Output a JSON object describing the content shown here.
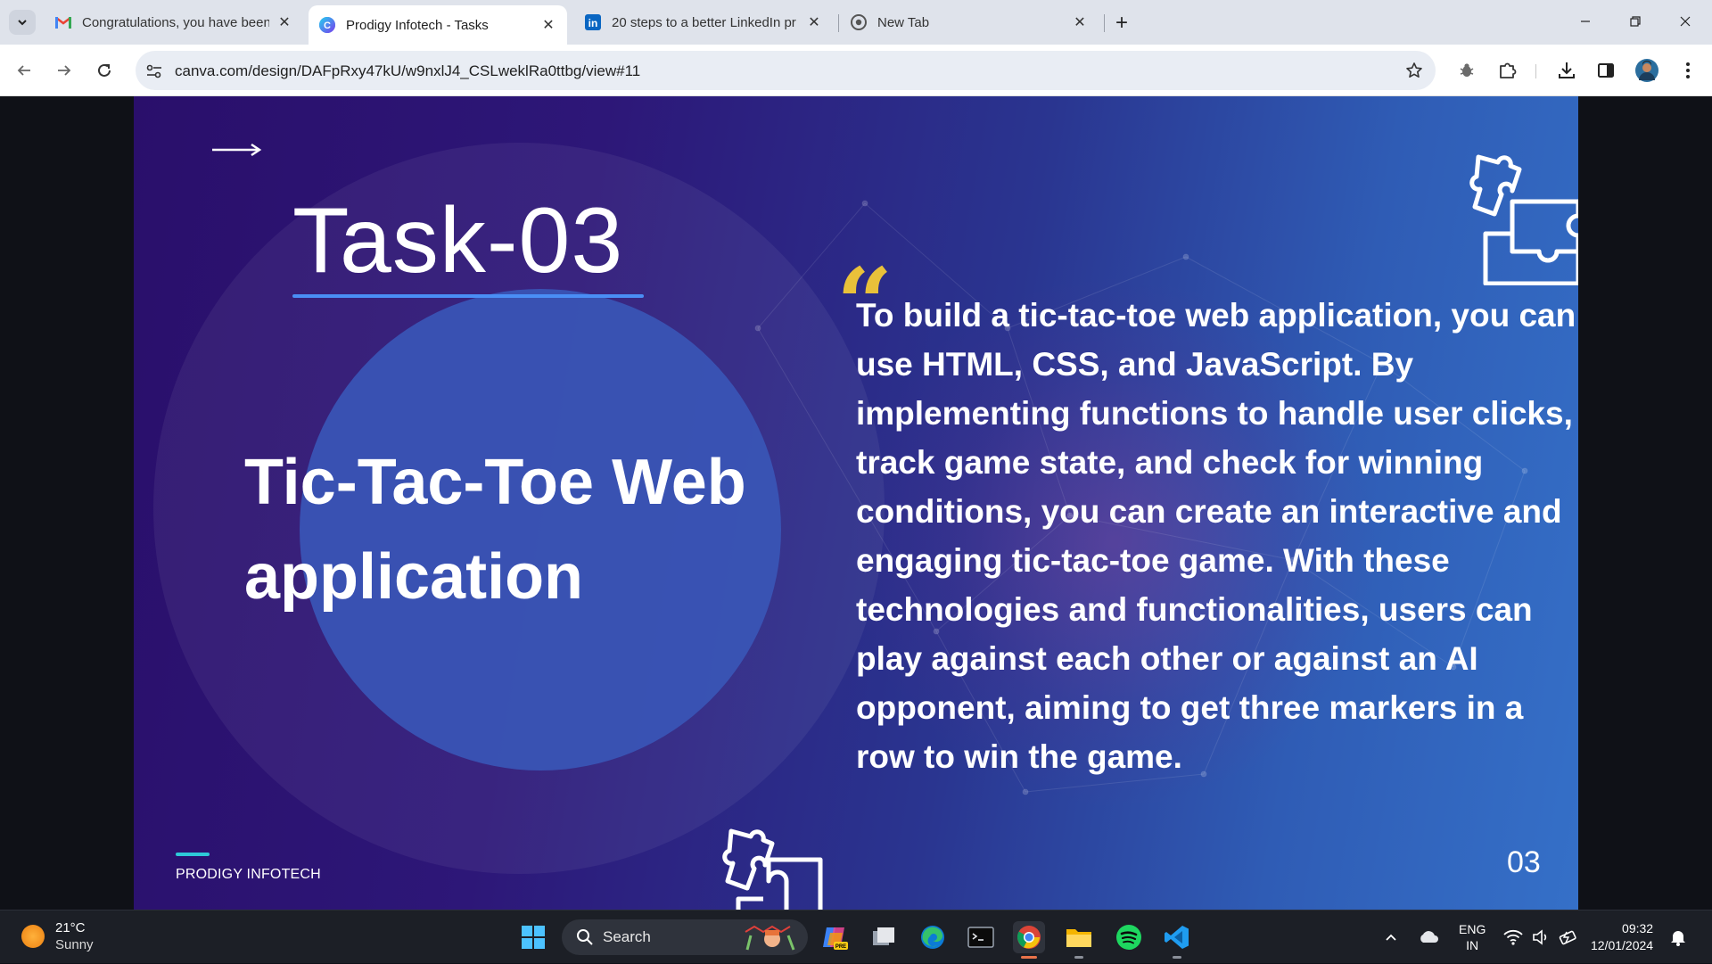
{
  "browser": {
    "tabs": [
      {
        "title": "Congratulations, you have been",
        "icon": "gmail-icon",
        "active": false
      },
      {
        "title": "Prodigy Infotech - Tasks",
        "icon": "canva-icon",
        "active": true
      },
      {
        "title": "20 steps to a better LinkedIn pr",
        "icon": "linkedin-icon",
        "active": false
      },
      {
        "title": "New Tab",
        "icon": "chrome-icon",
        "active": false
      }
    ],
    "url": "canva.com/design/DAFpRxy47kU/w9nxlJ4_CSLweklRa0ttbg/view#11",
    "colors": {
      "tabstrip": "#dfe3eb",
      "omnibox": "#e9edf4"
    }
  },
  "slide": {
    "task_label": "Task-03",
    "title": "Tic-Tac-Toe Web application",
    "quote_mark": "“",
    "body": "To build a tic-tac-toe web application, you can use HTML, CSS, and JavaScript. By implementing functions to handle user clicks, track game state, and check for winning conditions, you can create an interactive and engaging tic-tac-toe game. With these technologies and functionalities, users can play against each other or against an AI opponent, aiming to get three markers in a row to win the game.",
    "footer_brand": "PRODIGY INFOTECH",
    "page_number": "03",
    "colors": {
      "quote": "#e9c13a",
      "underline": "#4a8ef5",
      "footer_line": "#2ec9d8",
      "bg_start": "#2a0f6b",
      "bg_end": "#3570c8"
    }
  },
  "taskbar": {
    "weather": {
      "temp": "21°C",
      "condition": "Sunny"
    },
    "search_label": "Search",
    "apps": [
      "copilot-icon",
      "task-view-icon",
      "edge-icon",
      "terminal-icon",
      "chrome-icon",
      "file-explorer-icon",
      "spotify-icon",
      "vscode-icon"
    ],
    "language": {
      "line1": "ENG",
      "line2": "IN"
    },
    "clock": {
      "time": "09:32",
      "date": "12/01/2024"
    }
  }
}
